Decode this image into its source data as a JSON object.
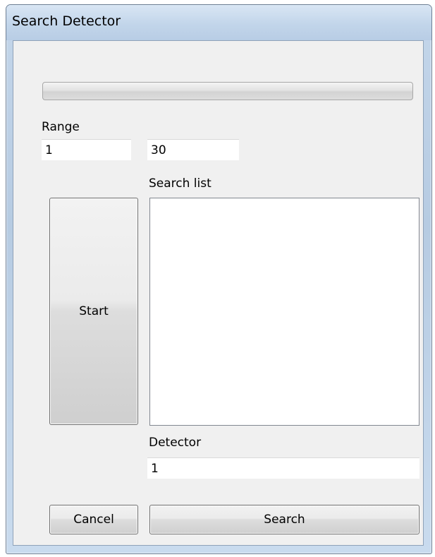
{
  "window": {
    "title": "Search Detector"
  },
  "progress": {
    "value": 0
  },
  "range": {
    "label": "Range",
    "from_value": "1",
    "to_value": "30"
  },
  "search_list": {
    "label": "Search list",
    "items": []
  },
  "buttons": {
    "start_label": "Start",
    "cancel_label": "Cancel",
    "search_label": "Search"
  },
  "detector": {
    "label": "Detector",
    "value": "1"
  }
}
